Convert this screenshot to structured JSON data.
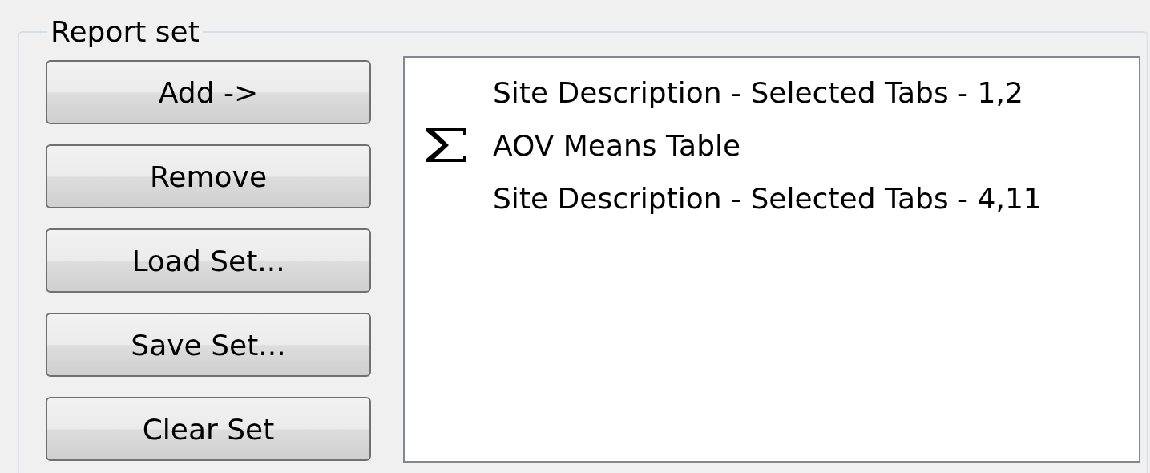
{
  "group": {
    "title": "Report set"
  },
  "buttons": [
    "Add ->",
    "Remove",
    "Load Set...",
    "Save Set...",
    "Clear Set"
  ],
  "report_items": [
    {
      "label": "Site Description - Selected Tabs - 1,2",
      "kind": "plain"
    },
    {
      "label": "AOV Means Table",
      "kind": "summary"
    },
    {
      "label": "Site Description - Selected Tabs - 4,11",
      "kind": "plain"
    }
  ]
}
